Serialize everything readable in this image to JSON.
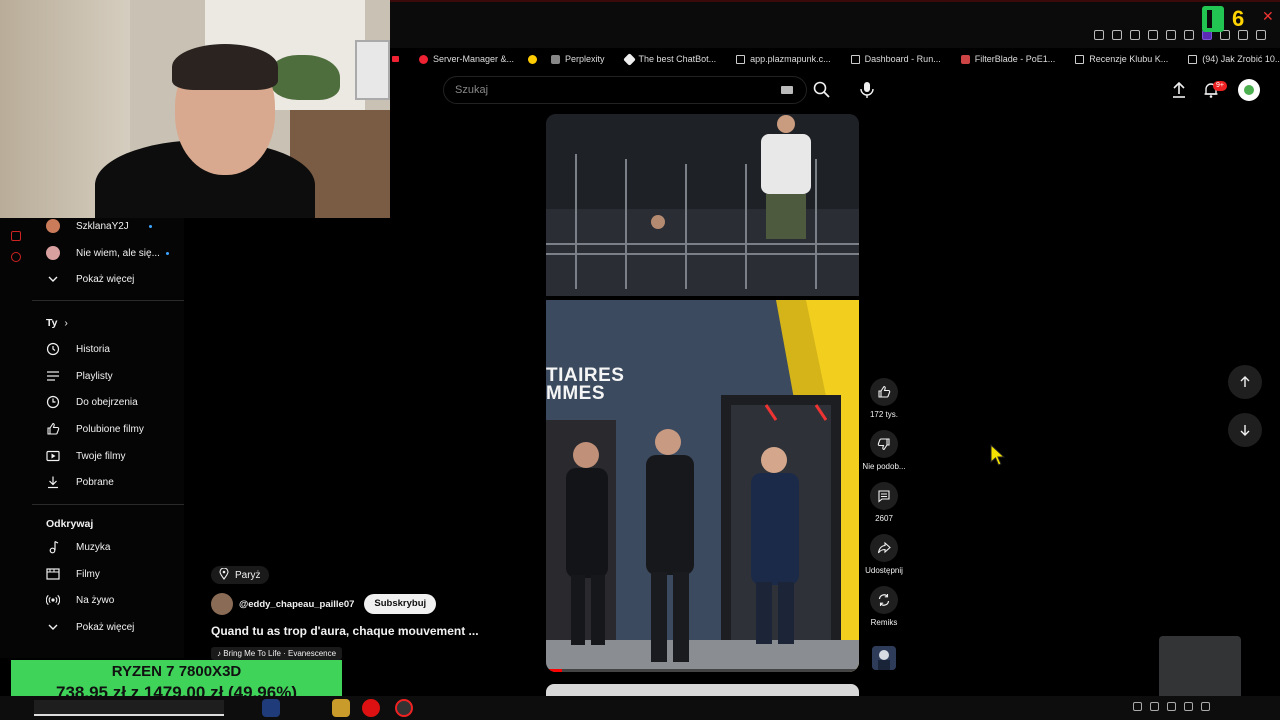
{
  "bookmarks": [
    {
      "label": "Server-Manager &...",
      "icon": "red-circle-icon"
    },
    {
      "label": "Perplexity",
      "icon": "perplexity-icon"
    },
    {
      "label": "The best ChatBot...",
      "icon": "chatbot-icon"
    },
    {
      "label": "app.plazmapunk.c...",
      "icon": "doc-icon"
    },
    {
      "label": "Dashboard - Run...",
      "icon": "doc-icon"
    },
    {
      "label": "FilterBlade - PoE1...",
      "icon": "filterblade-icon"
    },
    {
      "label": "Recenzje Klubu K...",
      "icon": "doc-icon"
    },
    {
      "label": "(94) Jak Zrobić 10...",
      "icon": "doc-icon"
    }
  ],
  "overlay": {
    "counter": "6"
  },
  "search": {
    "placeholder": "Szukaj"
  },
  "notifications": {
    "badge": "9+"
  },
  "sidebar": {
    "subscriptions": [
      {
        "label": "SzklanaY2J",
        "color": "#c97b5a"
      },
      {
        "label": "Nie wiem, ale się...",
        "color": "#d9a0a0"
      }
    ],
    "show_more_1": "Pokaż więcej",
    "you_section": "Ty",
    "you_items": [
      "Historia",
      "Playlisty",
      "Do obejrzenia",
      "Polubione filmy",
      "Twoje filmy",
      "Pobrane"
    ],
    "explore_section": "Odkrywaj",
    "explore_items": [
      "Muzyka",
      "Filmy",
      "Na żywo"
    ],
    "show_more_2": "Pokaż więcej"
  },
  "short": {
    "location": "Paryż",
    "channel": "@eddy_chapeau_paille07",
    "subscribe": "Subskrybuj",
    "title": "Quand tu as trop d'aura, chaque mouvement ...",
    "song": "Bring Me To Life · Evanescence",
    "sign_text": [
      "TIAIRES",
      "MMES"
    ],
    "progress_fraction": 0.05
  },
  "actions": {
    "likes": "172 tys.",
    "dislike": "Nie podob...",
    "comments": "2607",
    "share": "Udostępnij",
    "remix": "Remiks"
  },
  "promo": {
    "line1": "RYZEN 7 7800X3D",
    "line2": "738,95 zł z 1479,00 zł (49.96%)"
  },
  "colors": {
    "accent": "#ff0000",
    "link_dot": "#3ea6ff",
    "promo_bg": "#3fd35a"
  }
}
